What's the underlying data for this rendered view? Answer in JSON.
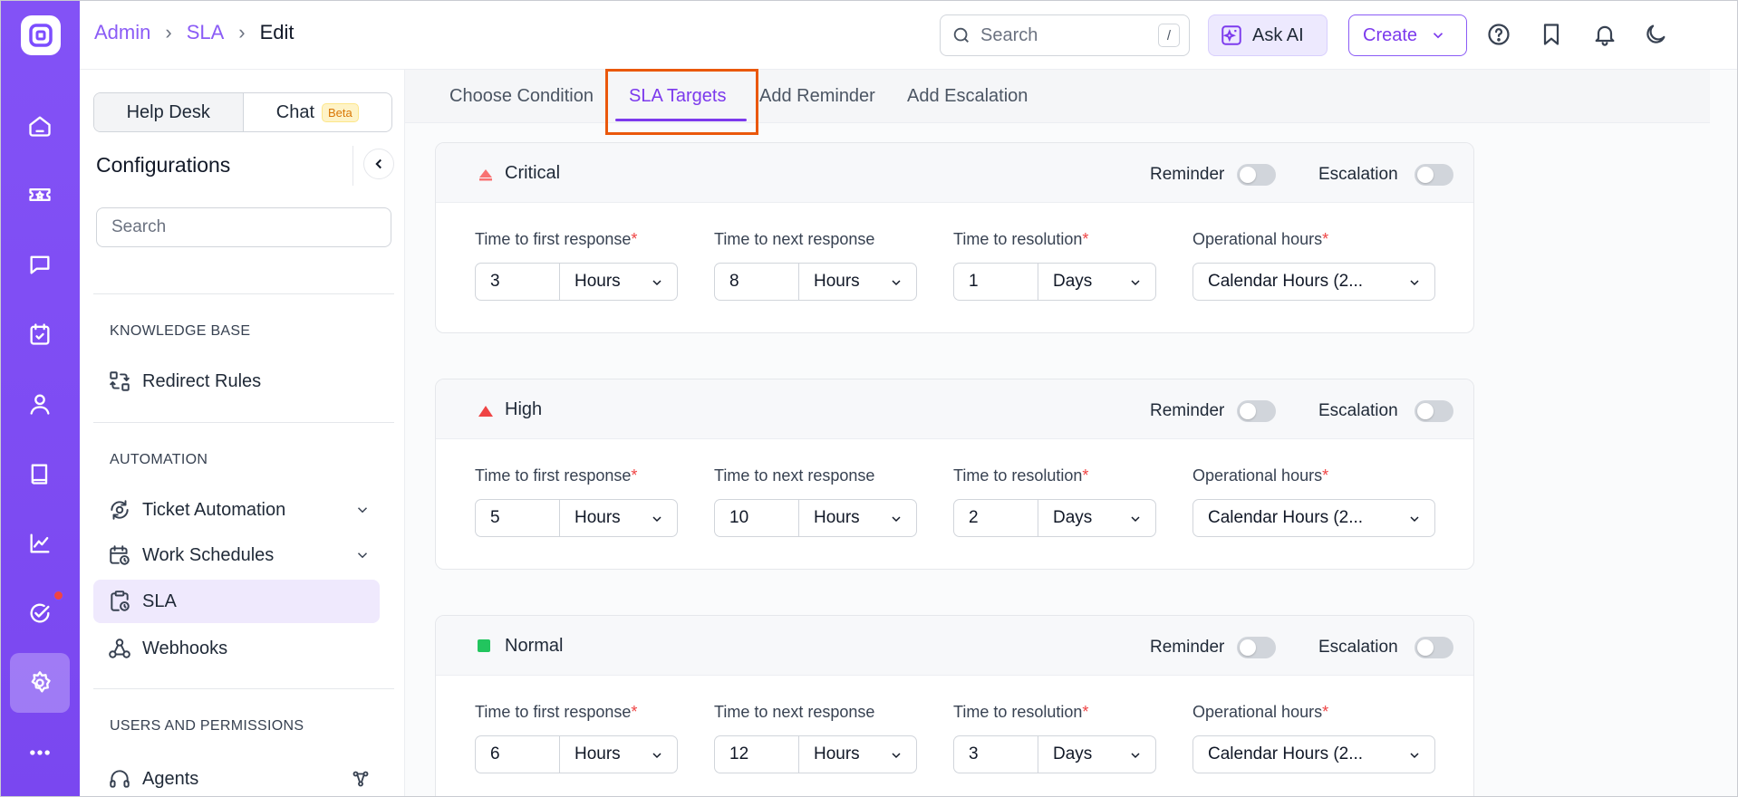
{
  "breadcrumb": {
    "root": "Admin",
    "section": "SLA",
    "current": "Edit"
  },
  "header": {
    "search_placeholder": "Search",
    "search_shortcut": "/",
    "ask_ai_label": "Ask AI",
    "create_label": "Create"
  },
  "config": {
    "tabs": {
      "helpdesk": "Help Desk",
      "chat": "Chat",
      "chat_badge": "Beta"
    },
    "title": "Configurations",
    "search_placeholder": "Search",
    "sections": [
      {
        "title": "KNOWLEDGE BASE",
        "items": [
          {
            "label": "Redirect Rules",
            "icon": "redirect-icon"
          }
        ]
      },
      {
        "title": "AUTOMATION",
        "items": [
          {
            "label": "Ticket Automation",
            "icon": "automation-icon",
            "expandable": true
          },
          {
            "label": "Work Schedules",
            "icon": "calendar-clock-icon",
            "expandable": true
          },
          {
            "label": "SLA",
            "icon": "clipboard-clock-icon",
            "active": true
          },
          {
            "label": "Webhooks",
            "icon": "webhook-icon"
          }
        ]
      },
      {
        "title": "USERS AND PERMISSIONS",
        "items": [
          {
            "label": "Agents",
            "icon": "headset-icon"
          }
        ]
      }
    ]
  },
  "tabs": [
    {
      "label": "Choose Condition"
    },
    {
      "label": "SLA Targets",
      "active": true
    },
    {
      "label": "Add Reminder"
    },
    {
      "label": "Add Escalation"
    }
  ],
  "labels": {
    "reminder": "Reminder",
    "escalation": "Escalation",
    "first_response": "Time to first response",
    "next_response": "Time to next response",
    "resolution": "Time to resolution",
    "operational_hours": "Operational hours",
    "required_mark": "*"
  },
  "targets": [
    {
      "priority": "Critical",
      "color": "#f87171",
      "first_value": "3",
      "first_unit": "Hours",
      "next_value": "8",
      "next_unit": "Hours",
      "resolution_value": "1",
      "resolution_unit": "Days",
      "operational_hours": "Calendar Hours (2...",
      "reminder": false,
      "escalation": false
    },
    {
      "priority": "High",
      "color": "#ef4444",
      "first_value": "5",
      "first_unit": "Hours",
      "next_value": "10",
      "next_unit": "Hours",
      "resolution_value": "2",
      "resolution_unit": "Days",
      "operational_hours": "Calendar Hours (2...",
      "reminder": false,
      "escalation": false
    },
    {
      "priority": "Normal",
      "color": "#22c55e",
      "first_value": "6",
      "first_unit": "Hours",
      "next_value": "12",
      "next_unit": "Hours",
      "resolution_value": "3",
      "resolution_unit": "Days",
      "operational_hours": "Calendar Hours (2...",
      "reminder": false,
      "escalation": false
    }
  ],
  "colors": {
    "accent": "#7c3aed",
    "rail": "#7c4dff",
    "highlight": "#ea580c"
  }
}
